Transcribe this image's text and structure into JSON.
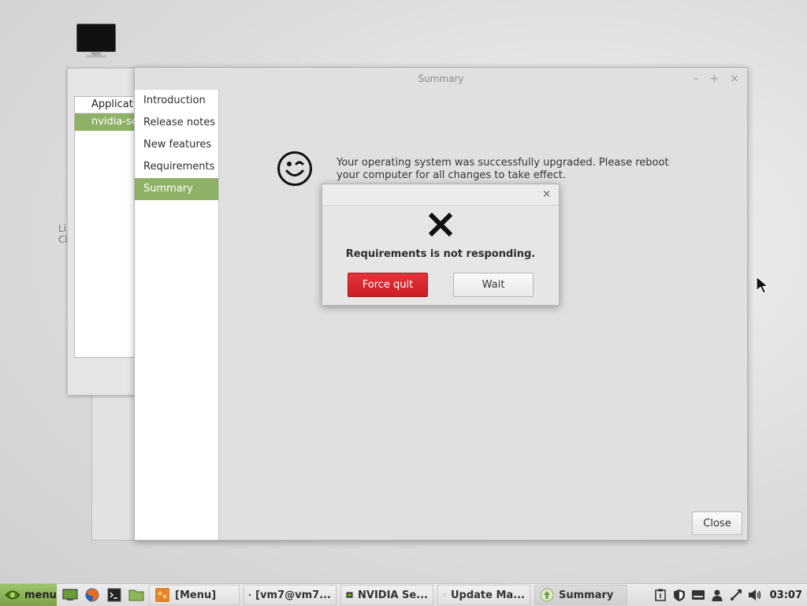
{
  "desktop": {
    "icon": "monitor-icon",
    "side_fragment": [
      "Li",
      "Cl"
    ]
  },
  "background_window": {
    "list_header": "Applicatio",
    "selected_row": "nvidia-se"
  },
  "main_window": {
    "title": "Summary",
    "controls": {
      "minimize": "–",
      "maximize": "+",
      "close": "×"
    },
    "sidebar": [
      "Introduction",
      "Release notes",
      "New features",
      "Requirements",
      "Summary"
    ],
    "active_item": "Summary",
    "message": "Your operating system was successfully upgraded. Please reboot your computer for all changes to take effect.",
    "message_icon": "winking-smiley-icon",
    "close_button": "Close"
  },
  "dialog": {
    "close": "×",
    "icon": "x-mark-icon",
    "text": "Requirements is not responding.",
    "force_quit": "Force quit",
    "wait": "Wait",
    "accent": "#d8242b"
  },
  "taskbar": {
    "menu_label": "menu",
    "quick_launch": [
      "show-desktop-icon",
      "firefox-icon",
      "terminal-icon",
      "files-icon"
    ],
    "items": [
      {
        "label": "[Menu]",
        "icon": "menu-editor-icon"
      },
      {
        "label": "[vm7@vm7...",
        "icon": "terminal-icon"
      },
      {
        "label": "NVIDIA Se...",
        "icon": "nvidia-icon"
      },
      {
        "label": "Update Ma...",
        "icon": "shield-icon"
      },
      {
        "label": "Summary",
        "icon": "upgrade-icon"
      }
    ],
    "tray": [
      "clipboard-icon",
      "shield-icon",
      "keyboard-icon",
      "user-icon",
      "network-icon",
      "volume-icon"
    ],
    "clock": "03:07",
    "accent": "#8fb167"
  }
}
